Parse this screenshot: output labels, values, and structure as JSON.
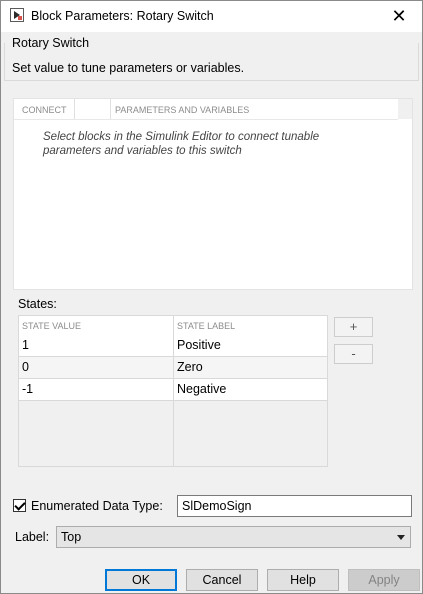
{
  "window": {
    "title": "Block Parameters: Rotary Switch",
    "close_glyph": "✕"
  },
  "group": {
    "title": "Rotary Switch",
    "description": "Set value to tune parameters or variables."
  },
  "connect_panel": {
    "columns": [
      "CONNECT",
      "PARAMETERS AND VARIABLES"
    ],
    "message": "Select blocks in the Simulink Editor to connect tunable parameters and variables to this switch"
  },
  "states": {
    "label": "States:",
    "columns": [
      "STATE VALUE",
      "STATE LABEL"
    ],
    "rows": [
      {
        "value": "1",
        "label": "Positive"
      },
      {
        "value": "0",
        "label": "Zero"
      },
      {
        "value": "-1",
        "label": "Negative"
      }
    ],
    "add_label": "+",
    "remove_label": "-"
  },
  "enumerated": {
    "checked": true,
    "label": "Enumerated Data Type:",
    "value": "SlDemoSign"
  },
  "label_field": {
    "label": "Label:",
    "selected": "Top"
  },
  "buttons": {
    "ok": "OK",
    "cancel": "Cancel",
    "help": "Help",
    "apply": "Apply"
  },
  "colors": {
    "primary_border": "#0078d7",
    "disabled_text": "#838383"
  }
}
